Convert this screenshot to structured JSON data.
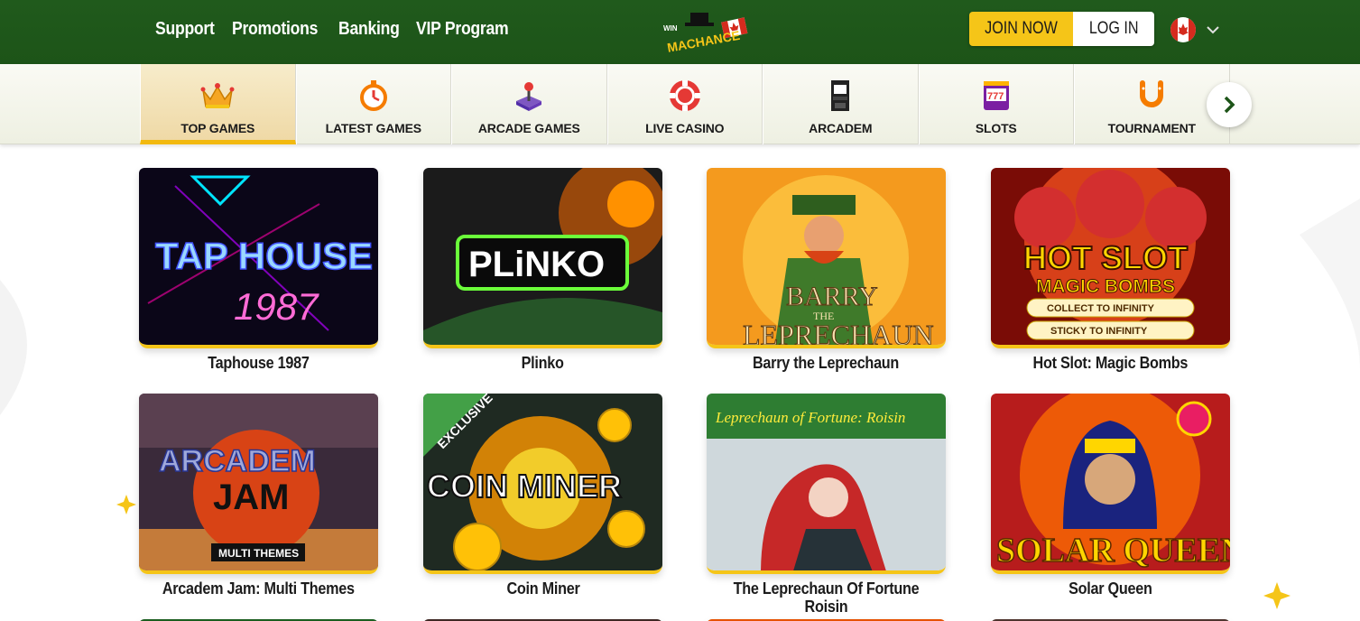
{
  "header": {
    "nav": [
      "Support",
      "Promotions",
      "Banking",
      "VIP Program"
    ],
    "logo_text_top": "WIN",
    "logo_text_main": "MACHANCE",
    "join_label": "JOIN NOW",
    "login_label": "LOG IN",
    "language_icon": "canada-flag-icon"
  },
  "categories": [
    {
      "label": "TOP GAMES",
      "icon": "crown-icon",
      "active": true
    },
    {
      "label": "LATEST GAMES",
      "icon": "stopwatch-icon",
      "active": false
    },
    {
      "label": "ARCADE GAMES",
      "icon": "joystick-icon",
      "active": false
    },
    {
      "label": "LIVE CASINO",
      "icon": "poker-chip-icon",
      "active": false
    },
    {
      "label": "ARCADEM",
      "icon": "arcade-cabinet-icon",
      "active": false
    },
    {
      "label": "SLOTS",
      "icon": "slot-machine-icon",
      "active": false
    },
    {
      "label": "TOURNAMENT",
      "icon": "horseshoe-icon",
      "active": false
    }
  ],
  "games": [
    {
      "title": "Taphouse 1987",
      "art_line1": "TAP HOUSE",
      "art_line2": "1987"
    },
    {
      "title": "Plinko",
      "art_line1": "PLiNKO"
    },
    {
      "title": "Barry the Leprechaun",
      "art_line1": "BARRY",
      "art_line2": "THE",
      "art_line3": "LEPRECHAUN"
    },
    {
      "title": "Hot Slot: Magic Bombs",
      "art_line1": "HOT SLOT",
      "art_line2": "MAGIC BOMBS",
      "art_line3": "COLLECT TO INFINITY",
      "art_line4": "STICKY TO INFINITY"
    },
    {
      "title": "Arcadem Jam: Multi Themes",
      "art_line1": "ARCADEM",
      "art_line2": "JAM",
      "art_line3": "MULTI THEMES"
    },
    {
      "title": "Coin Miner",
      "art_line1": "COIN MINER",
      "art_badge": "EXCLUSIVE"
    },
    {
      "title": "The Leprechaun Of Fortune Roisin",
      "art_line1": "Leprechaun of Fortune: Roisin"
    },
    {
      "title": "Solar Queen",
      "art_line1": "SOLAR QUEEN"
    }
  ],
  "colors": {
    "header_green": "#1d5418",
    "accent_yellow": "#f5c518"
  }
}
